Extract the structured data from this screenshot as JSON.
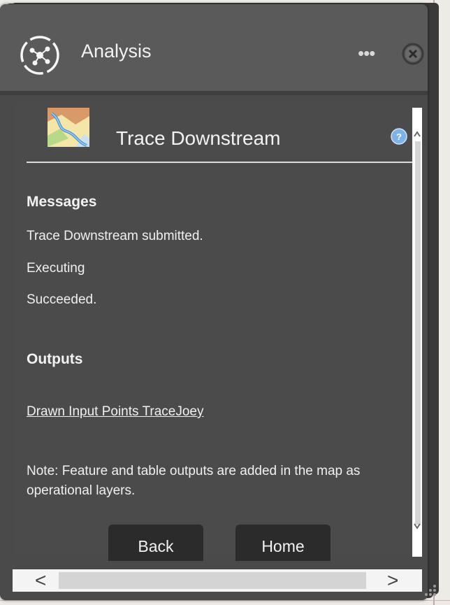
{
  "header": {
    "title": "Analysis",
    "more_label": "•••"
  },
  "tool": {
    "title": "Trace Downstream"
  },
  "messages": {
    "heading": "Messages",
    "items": [
      "Trace Downstream submitted.",
      "Executing",
      "Succeeded."
    ]
  },
  "outputs": {
    "heading": "Outputs",
    "link": "Drawn Input Points TraceJoey"
  },
  "note": "Note: Feature and table outputs are added in the map as operational layers.",
  "buttons": {
    "back": "Back",
    "home": "Home"
  },
  "scrollbar": {
    "left_arrow": "<",
    "right_arrow": ">"
  },
  "colors": {
    "panel_bg": "#4a4a4a",
    "header_bg": "#5a5a5a",
    "button_bg": "#2b2b2b",
    "text": "#f2f2f2",
    "help_blue": "#7db3e8"
  },
  "icons": [
    "analysis-network-icon",
    "more-dots-icon",
    "close-circle-icon",
    "trace-map-thumbnail",
    "help-question-icon",
    "resize-grip-icon"
  ]
}
